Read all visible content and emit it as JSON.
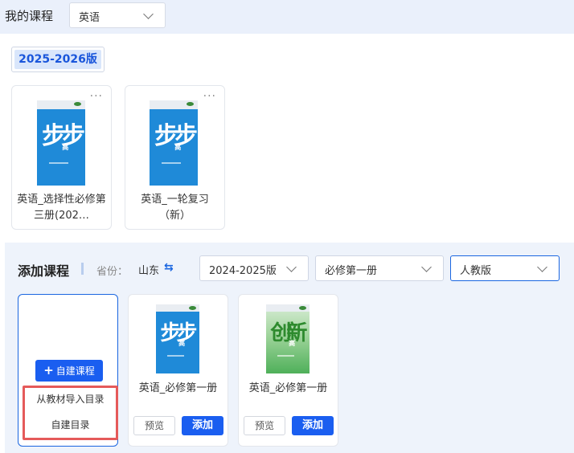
{
  "header": {
    "title": "我的课程",
    "subject": "英语"
  },
  "version_badge": "2025-2026版",
  "my_courses": [
    {
      "label": "英语_选择性必修第三册(202…",
      "book": {
        "title_art": "步步",
        "subtitle": "高"
      }
    },
    {
      "label": "英语_一轮复习（新）",
      "book": {
        "title_art": "步步",
        "subtitle": "高"
      }
    }
  ],
  "more_label": "···",
  "add_course": {
    "title": "添加课程",
    "province_label": "省份：",
    "province_value": "山东",
    "swap_icon": "⇆",
    "selects": {
      "year": "2024-2025版",
      "volume": "必修第一册",
      "edition": "人教版"
    },
    "self_build": {
      "button_label": "自建课程",
      "plus": "+",
      "menu": [
        "从教材导入目录",
        "自建目录"
      ]
    },
    "cards": [
      {
        "label": "英语_必修第一册",
        "book_color": "blue",
        "title_art": "步步",
        "subtitle": "高",
        "preview_label": "预览",
        "add_label": "添加"
      },
      {
        "label": "英语_必修第一册",
        "book_color": "green",
        "title_art": "创新",
        "subtitle": "高",
        "preview_label": "预览",
        "add_label": "添加"
      }
    ]
  },
  "colors": {
    "accent": "#1a5ef0",
    "highlight_border": "#e55a5a",
    "topbar_bg": "#eaf0fb"
  },
  "icons": [
    "chevron-down-icon",
    "more-icon",
    "swap-icon",
    "plus-icon"
  ]
}
